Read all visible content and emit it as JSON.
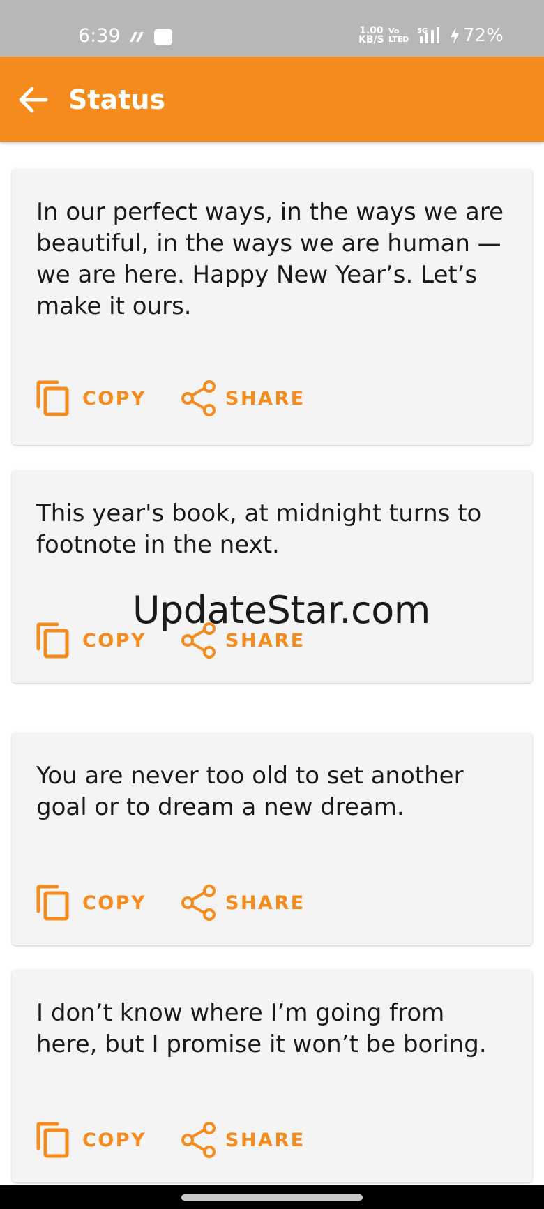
{
  "status_bar": {
    "time": "6:39",
    "net_speed_value": "1.00",
    "net_speed_unit": "KB/S",
    "volte_top": "Vo",
    "volte_bottom": "LTED",
    "network_type": "5G",
    "battery": "72%"
  },
  "app_bar": {
    "title": "Status",
    "color": "#f68b1d",
    "back_icon": "arrow-left-icon"
  },
  "cards": [
    {
      "text": "In our perfect ways, in the ways we are beautiful, in the ways we are human — we are here. Happy New Year’s. Let’s make it ours.",
      "copy_label": "COPY",
      "share_label": "SHARE"
    },
    {
      "text": "This year's book, at midnight turns to footnote in the next.",
      "copy_label": "COPY",
      "share_label": "SHARE"
    },
    {
      "text": "You are never too old to set another goal or to dream a new dream.",
      "copy_label": "COPY",
      "share_label": "SHARE"
    },
    {
      "text": "I don’t know where I’m going from here, but I promise it won’t be boring.",
      "copy_label": "COPY",
      "share_label": "SHARE"
    }
  ],
  "watermark": "UpdateStar.com",
  "icons": {
    "copy": "copy-icon",
    "share": "share-icon"
  },
  "colors": {
    "accent": "#f68b1d",
    "card_background": "#f4f4f4",
    "status_bar": "#b7b7b7"
  }
}
